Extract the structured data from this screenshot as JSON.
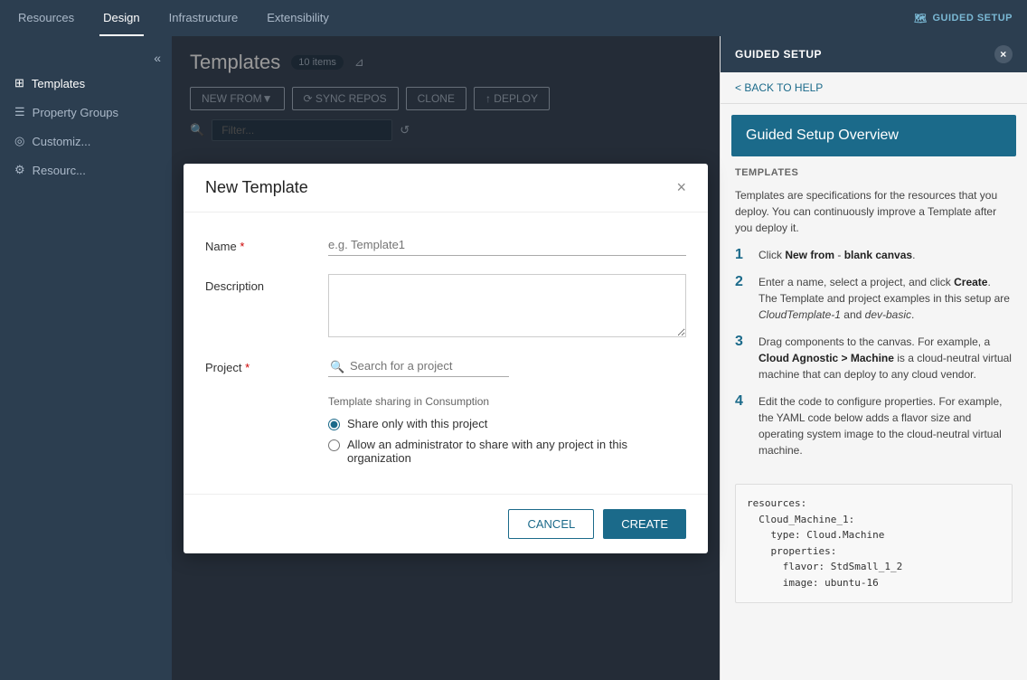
{
  "nav": {
    "items": [
      {
        "label": "Resources",
        "active": false
      },
      {
        "label": "Design",
        "active": true
      },
      {
        "label": "Infrastructure",
        "active": false
      },
      {
        "label": "Extensibility",
        "active": false
      }
    ],
    "guided_setup_label": "GUIDED SETUP"
  },
  "sidebar": {
    "collapse_icon": "«",
    "items": [
      {
        "label": "Templates",
        "icon": "⊞"
      },
      {
        "label": "Property Groups",
        "icon": "☰"
      },
      {
        "label": "Customiz...",
        "icon": "◎"
      },
      {
        "label": "Resourc...",
        "icon": "⚙"
      }
    ]
  },
  "content": {
    "title": "Templates",
    "items_count": "10 items",
    "toolbar": {
      "new_from_label": "NEW FROM▼",
      "sync_repos_label": "⟳  SYNC REPOS",
      "clone_label": "CLONE",
      "deploy_label": "↑  DEPLOY",
      "filter_placeholder": "Filter..."
    }
  },
  "modal": {
    "title": "New Template",
    "fields": {
      "name_label": "Name",
      "name_placeholder": "e.g. Template1",
      "description_label": "Description",
      "description_placeholder": "",
      "project_label": "Project",
      "project_placeholder": "Search for a project"
    },
    "sharing": {
      "section_label": "Template sharing in Consumption",
      "option1_label": "Share only with this project",
      "option2_label": "Allow an administrator to share with any project in this organization"
    },
    "cancel_label": "CANCEL",
    "create_label": "CREATE"
  },
  "guided_panel": {
    "header": "GUIDED SETUP",
    "close_icon": "×",
    "back_label": "< BACK TO HELP",
    "overview_title": "Guided Setup Overview",
    "section_title": "TEMPLATES",
    "intro_text": "Templates are specifications for the resources that you deploy. You can continuously improve a Template after you deploy it.",
    "steps": [
      {
        "num": "1",
        "text_parts": [
          {
            "text": "Click ",
            "bold": false
          },
          {
            "text": "New from",
            "bold": true
          },
          {
            "text": " - ",
            "bold": false
          },
          {
            "text": "blank canvas",
            "bold": true
          },
          {
            "text": ".",
            "bold": false
          }
        ]
      },
      {
        "num": "2",
        "text_parts": [
          {
            "text": "Enter a name, select a project, and click ",
            "bold": false
          },
          {
            "text": "Create",
            "bold": true
          },
          {
            "text": ".",
            "bold": false
          }
        ],
        "sub_text": "The Template and project examples in this setup are CloudTemplate-1 and dev-basic.",
        "italic_words": [
          "CloudTemplate-1",
          "dev-basic"
        ]
      },
      {
        "num": "3",
        "text": "Drag components to the canvas. For example, a Cloud Agnostic > Machine is a cloud-neutral virtual machine that can deploy to any cloud vendor."
      },
      {
        "num": "4",
        "text": "Edit the code to configure properties. For example, the YAML code below adds a flavor size and operating system image to the cloud-neutral virtual machine."
      }
    ],
    "code_block": "resources:\n  Cloud_Machine_1:\n    type: Cloud.Machine\n    properties:\n      flavor: StdSmall_1_2\n      image: ubuntu-16"
  }
}
